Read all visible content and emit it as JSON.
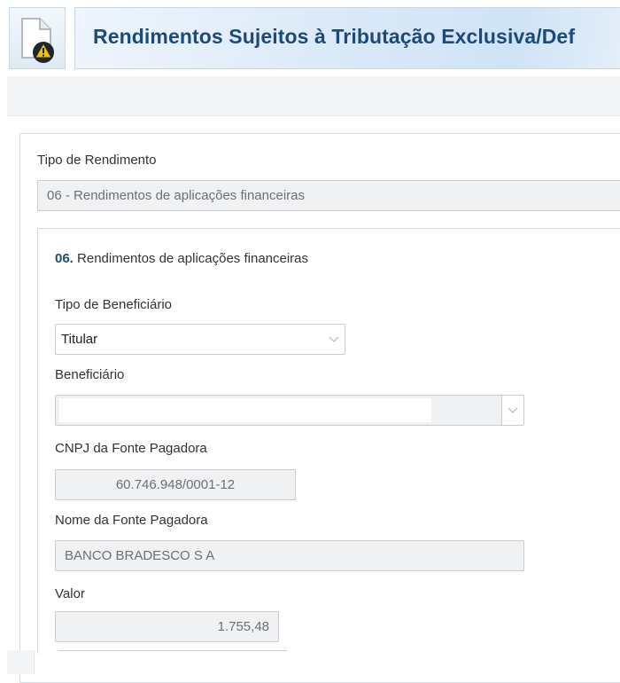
{
  "header": {
    "title": "Rendimentos Sujeitos à Tributação Exclusiva/Def"
  },
  "form": {
    "tipo_rendimento_label": "Tipo de Rendimento",
    "tipo_rendimento_value": "06 - Rendimentos de aplicações financeiras",
    "section": {
      "code": "06.",
      "name": "Rendimentos de aplicações financeiras"
    },
    "tipo_beneficiario_label": "Tipo de Beneficiário",
    "tipo_beneficiario_value": "Titular",
    "beneficiario_label": "Beneficiário",
    "beneficiario_value": "",
    "cnpj_label": "CNPJ da Fonte Pagadora",
    "cnpj_value": "60.746.948/0001-12",
    "nome_fonte_label": "Nome da Fonte Pagadora",
    "nome_fonte_value": "BANCO BRADESCO S A",
    "valor_label": "Valor",
    "valor_value": "1.755,48"
  },
  "icons": {
    "document": "document-warning-icon",
    "chevron": "chevron-down-icon"
  },
  "colors": {
    "title": "#1c4a7a",
    "section_code": "#1c4a7a",
    "warning": "#f2c200"
  }
}
